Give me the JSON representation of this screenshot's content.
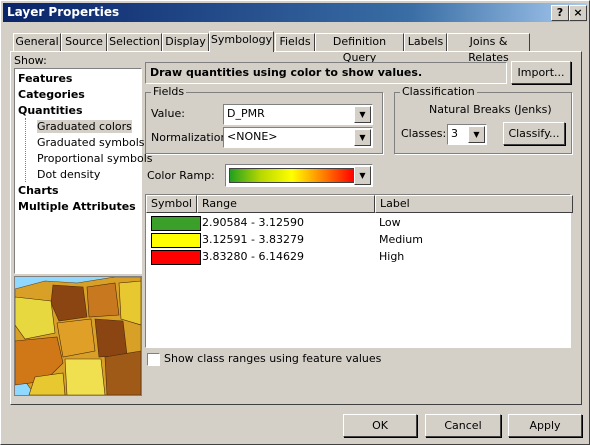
{
  "window": {
    "title": "Layer Properties",
    "help_btn": "?",
    "close_btn": "×"
  },
  "tabs": [
    "General",
    "Source",
    "Selection",
    "Display",
    "Symbology",
    "Fields",
    "Definition Query",
    "Labels",
    "Joins & Relates"
  ],
  "show": {
    "label": "Show:",
    "items": [
      {
        "label": "Features",
        "bold": true
      },
      {
        "label": "Categories",
        "bold": true
      },
      {
        "label": "Quantities",
        "bold": true
      },
      {
        "label": "Graduated colors",
        "bold": false,
        "selected": true
      },
      {
        "label": "Graduated symbols",
        "bold": false
      },
      {
        "label": "Proportional symbols",
        "bold": false
      },
      {
        "label": "Dot density",
        "bold": false
      },
      {
        "label": "Charts",
        "bold": true
      },
      {
        "label": "Multiple Attributes",
        "bold": true
      }
    ]
  },
  "header": {
    "description": "Draw quantities using color to show values.",
    "import_label": "Import..."
  },
  "fields": {
    "group_label": "Fields",
    "value_label": "Value:",
    "value": "D_PMR",
    "normalization_label": "Normalization:",
    "normalization": "<NONE>"
  },
  "classification": {
    "group_label": "Classification",
    "method": "Natural Breaks (Jenks)",
    "classes_label": "Classes:",
    "classes": "3",
    "classify_label": "Classify..."
  },
  "color_ramp": {
    "label": "Color Ramp:",
    "colors": [
      "#22a020",
      "#b8d800",
      "#ffff00",
      "#ff8000",
      "#ff0000"
    ]
  },
  "table": {
    "headers": [
      "Symbol",
      "Range",
      "Label"
    ],
    "rows": [
      {
        "color": "#3aa02a",
        "range": "2.90584 - 3.12590",
        "label": "Low"
      },
      {
        "color": "#ffff00",
        "range": "3.12591 - 3.83279",
        "label": "Medium"
      },
      {
        "color": "#ff0000",
        "range": "3.83280 - 6.14629",
        "label": "High"
      }
    ]
  },
  "show_ranges_label": "Show class ranges using feature values",
  "footer": {
    "ok": "OK",
    "cancel": "Cancel",
    "apply": "Apply"
  }
}
